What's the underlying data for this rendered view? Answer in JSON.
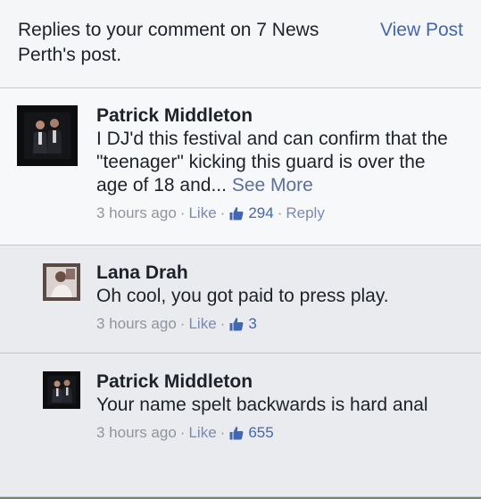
{
  "header": {
    "title": "Replies to your comment on 7 News Perth's post.",
    "view_post": "View Post"
  },
  "comments": [
    {
      "author": "Patrick Middleton",
      "text": "I DJ'd this festival and can confirm that the \"teenager\" kicking this guard is over the age of 18 and...",
      "see_more": "See More",
      "time": "3 hours ago",
      "like": "Like",
      "likes": "294",
      "reply": "Reply"
    },
    {
      "author": "Lana Drah",
      "text": "Oh cool, you got paid to press play.",
      "time": "3 hours ago",
      "like": "Like",
      "likes": "3"
    },
    {
      "author": "Patrick Middleton",
      "text": "Your name spelt backwards is hard anal",
      "time": "3 hours ago",
      "like": "Like",
      "likes": "655"
    }
  ],
  "separator": "·",
  "colors": {
    "link_blue": "#4267b2",
    "meta_grey": "#90949c",
    "reply_background": "#e9ebee"
  },
  "icons": {
    "like_count": "thumbs-up-icon",
    "avatar": "profile-photo-icon"
  }
}
